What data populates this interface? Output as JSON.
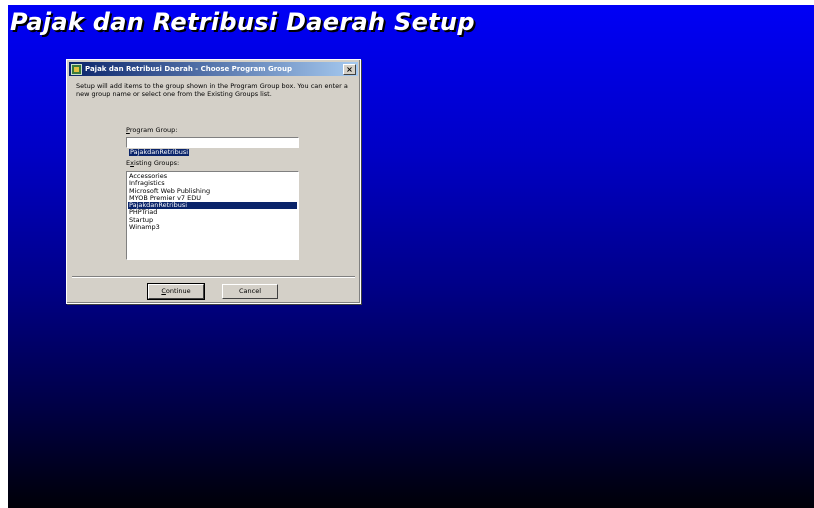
{
  "setup": {
    "title": "Pajak dan Retribusi Daerah Setup"
  },
  "dialog": {
    "title": "Pajak dan Retribusi Daerah - Choose Program Group",
    "close_label": "×",
    "description": "Setup will add items to the group shown in the Program Group box. You can enter a new group name or select one from the Existing Groups list.",
    "program_group_label_accel": "P",
    "program_group_label_rest": "rogram Group:",
    "program_group_value": "PajakdanRetribusi",
    "existing_groups_label_pre": "E",
    "existing_groups_label_accel": "x",
    "existing_groups_label_rest": "isting Groups:",
    "existing_groups": [
      "Accessories",
      "Infragistics",
      "Microsoft Web Publishing",
      "MYOB Premier v7 EDU",
      "PajakdanRetribusi",
      "PHPTriad",
      "Startup",
      "Winamp3"
    ],
    "selected_group": "PajakdanRetribusi",
    "continue_accel": "C",
    "continue_rest": "ontinue",
    "cancel_label": "Cancel"
  },
  "colors": {
    "background_top": "#0000f6",
    "background_bottom": "#000008",
    "titlebar_active": "#0a246a",
    "selection": "#0a246a",
    "dialog_face": "#d4d0c8"
  }
}
